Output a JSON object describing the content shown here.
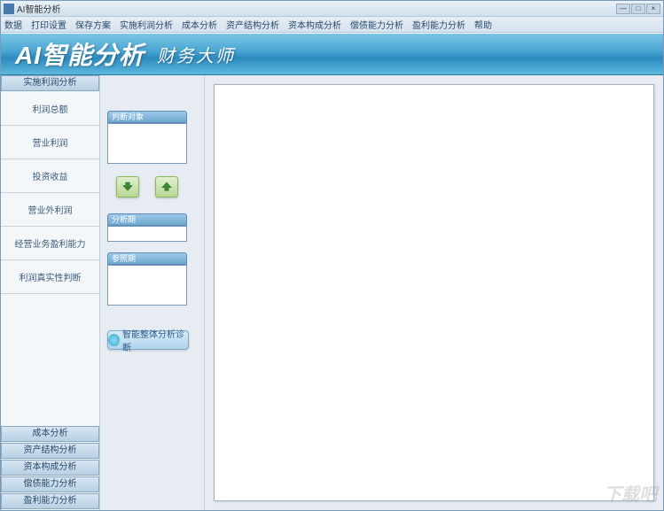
{
  "window": {
    "title": "AI智能分析"
  },
  "winctrl": {
    "min": "—",
    "max": "□",
    "close": "×"
  },
  "menu": [
    "数据",
    "打印设置",
    "保存方案",
    "实施利润分析",
    "成本分析",
    "资产结构分析",
    "资本构成分析",
    "偿债能力分析",
    "盈利能力分析",
    "帮助"
  ],
  "banner": {
    "logo": "AI智能分析",
    "sub": "财务大师"
  },
  "sidebar": {
    "top_header": "实施利润分析",
    "items": [
      "利润总额",
      "营业利润",
      "投资收益",
      "营业外利润",
      "经营业务盈利能力",
      "利润真实性判断"
    ],
    "bottom": [
      "成本分析",
      "资产结构分析",
      "资本构成分析",
      "偿债能力分析",
      "盈利能力分析"
    ]
  },
  "midpanel": {
    "label1": "判断对象",
    "label2": "分析期",
    "label3": "参照期",
    "diag_button": "智能整体分析诊断"
  },
  "watermark": "下载吧"
}
